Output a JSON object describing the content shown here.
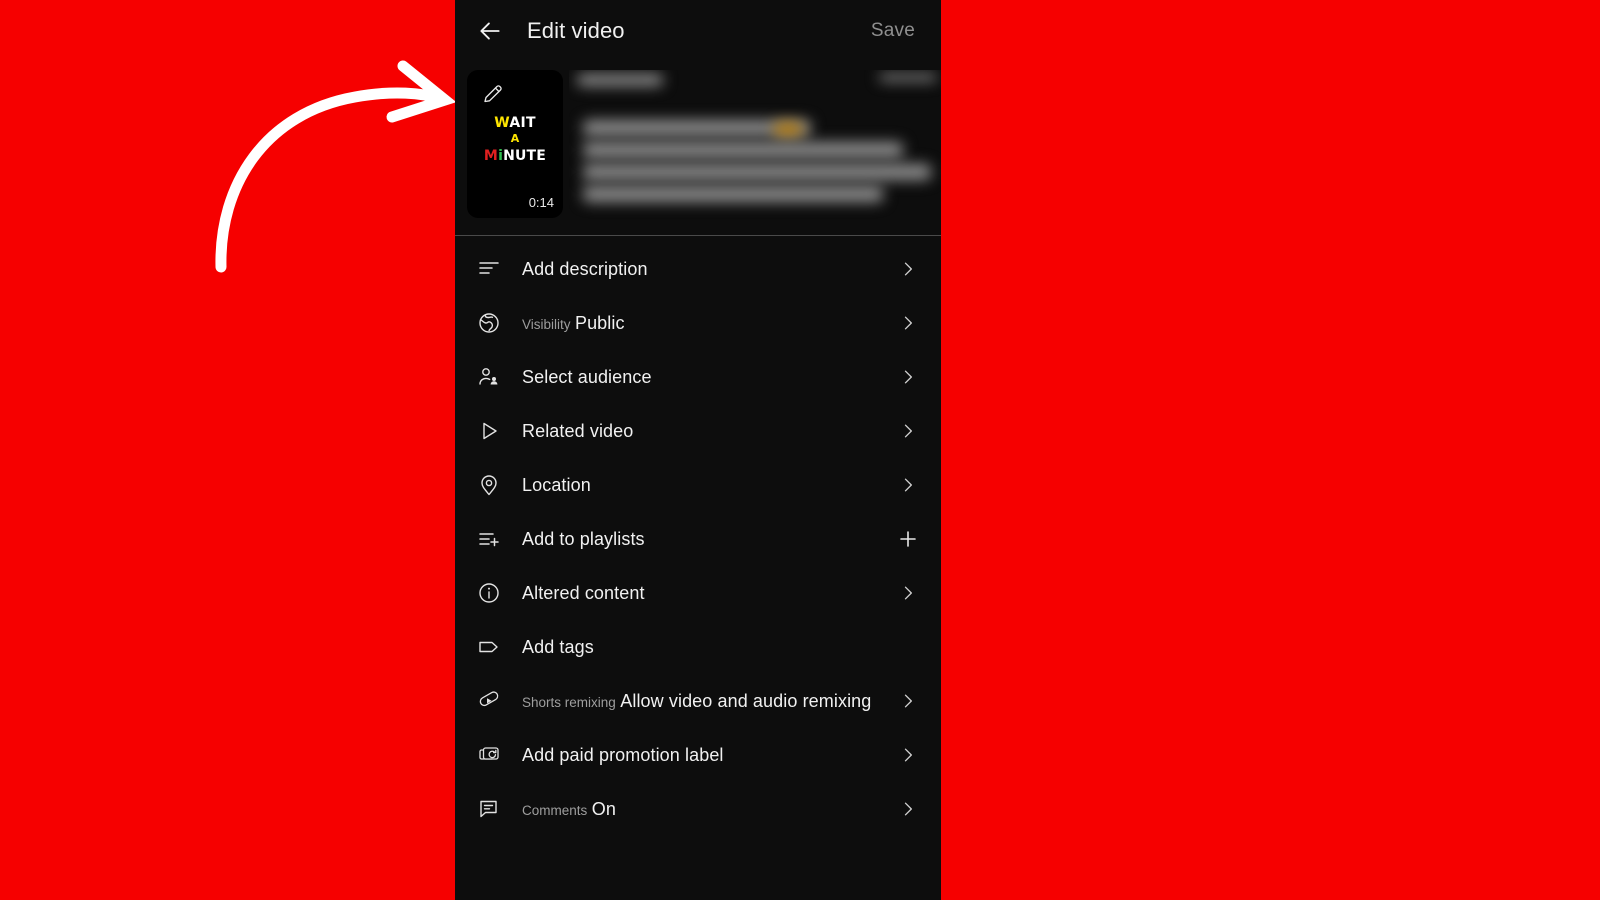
{
  "background": {
    "color": "#f60000"
  },
  "annotation": {
    "name": "curved-arrow-pointing-to-thumbnail",
    "color": "#ffffff"
  },
  "header": {
    "back_icon": "arrow-left-icon",
    "title": "Edit video",
    "save_label": "Save",
    "save_color": "#8f8f8f"
  },
  "video": {
    "edit_icon": "pencil-icon",
    "thumbnail_text": {
      "line1_a": "W",
      "line1_b": "AIT",
      "line2": "A",
      "line3_a": "M",
      "line3_b": "i",
      "line3_c": "NUTE"
    },
    "duration": "0:14",
    "title_blurred": true
  },
  "menu": {
    "items": [
      {
        "icon": "description-lines-icon",
        "label": "Add description",
        "sublabel": "",
        "trailing": "chevron"
      },
      {
        "icon": "globe-icon",
        "label": "Public",
        "sublabel": "Visibility",
        "trailing": "chevron"
      },
      {
        "icon": "person-add-icon",
        "label": "Select audience",
        "sublabel": "",
        "trailing": "chevron"
      },
      {
        "icon": "play-triangle-icon",
        "label": "Related video",
        "sublabel": "",
        "trailing": "chevron"
      },
      {
        "icon": "location-pin-icon",
        "label": "Location",
        "sublabel": "",
        "trailing": "chevron"
      },
      {
        "icon": "playlist-add-icon",
        "label": "Add to playlists",
        "sublabel": "",
        "trailing": "plus"
      },
      {
        "icon": "info-circle-icon",
        "label": "Altered content",
        "sublabel": "",
        "trailing": "chevron"
      },
      {
        "icon": "tag-icon",
        "label": "Add tags",
        "sublabel": "",
        "trailing": "none"
      },
      {
        "icon": "shorts-remix-icon",
        "label": "Allow video and audio remixing",
        "sublabel": "Shorts remixing",
        "trailing": "chevron"
      },
      {
        "icon": "paid-promotion-icon",
        "label": "Add paid promotion label",
        "sublabel": "",
        "trailing": "chevron"
      },
      {
        "icon": "comment-icon",
        "label": "On",
        "sublabel": "Comments",
        "trailing": "chevron"
      }
    ]
  }
}
